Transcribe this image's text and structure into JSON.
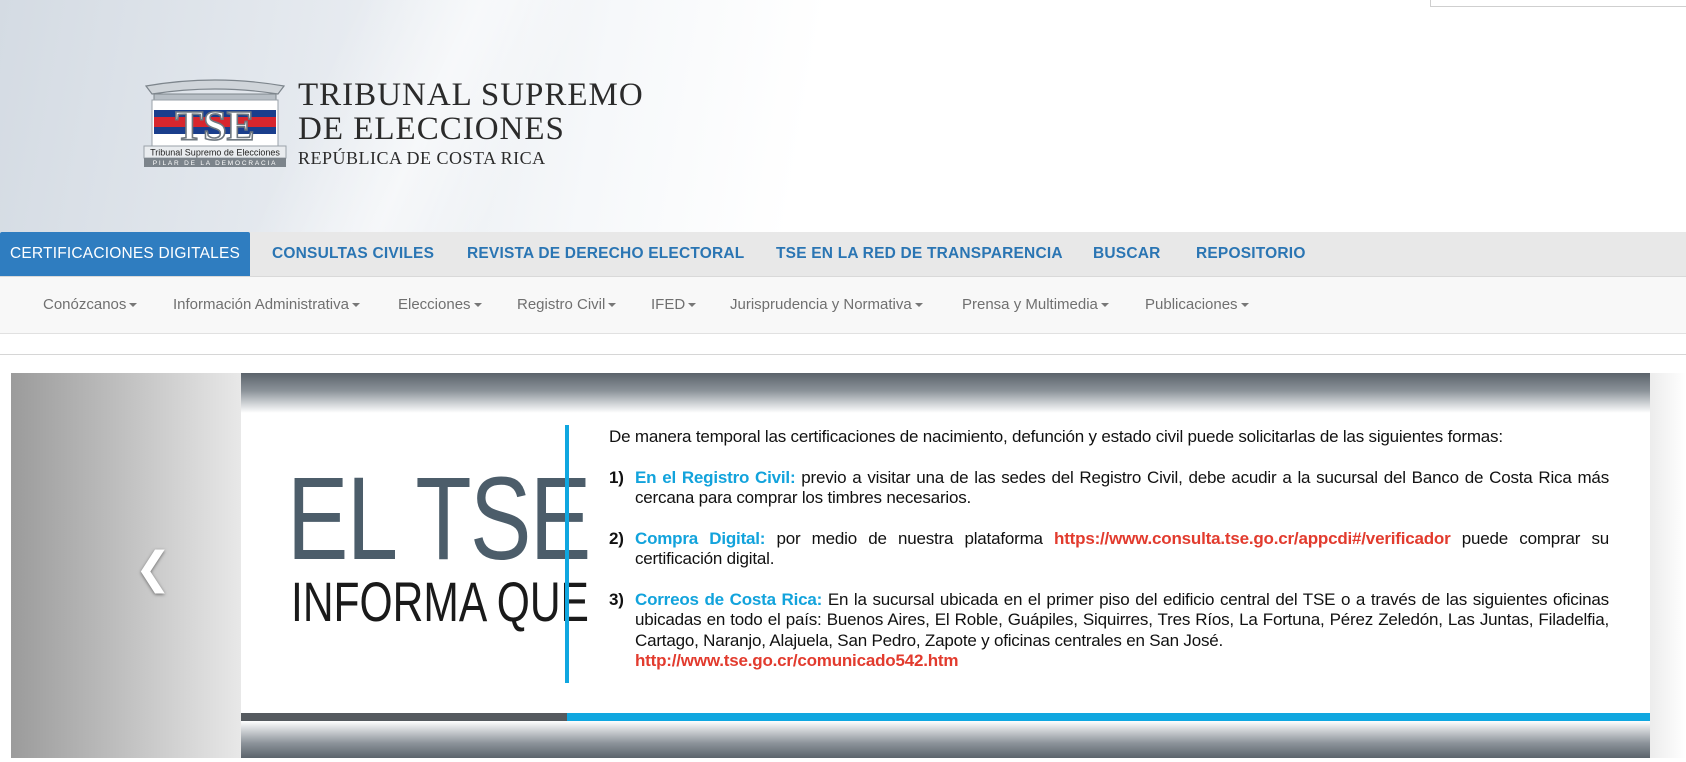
{
  "header": {
    "logo_text": "TSE",
    "logo_subtitle": "Tribunal Supremo de Elecciones",
    "logo_motto": "PILAR DE LA DEMOCRACIA",
    "title_line1": "TRIBUNAL SUPREMO",
    "title_line2": "DE ELECCIONES",
    "title_line3": "REPÚBLICA DE COSTA RICA"
  },
  "main_nav": {
    "items": [
      {
        "label": "CERTIFICACIONES DIGITALES",
        "active": true
      },
      {
        "label": "CONSULTAS CIVILES"
      },
      {
        "label": "REVISTA DE DERECHO ELECTORAL"
      },
      {
        "label": "TSE EN LA RED DE TRANSPARENCIA"
      },
      {
        "label": "BUSCAR"
      },
      {
        "label": "REPOSITORIO"
      }
    ]
  },
  "sub_nav": {
    "items": [
      {
        "label": "Conózcanos"
      },
      {
        "label": "Información Administrativa"
      },
      {
        "label": "Elecciones"
      },
      {
        "label": "Registro Civil"
      },
      {
        "label": "IFED"
      },
      {
        "label": "Jurisprudencia y Normativa"
      },
      {
        "label": "Prensa y Multimedia"
      },
      {
        "label": "Publicaciones"
      }
    ]
  },
  "carousel": {
    "prev_icon": "chevron-left-icon",
    "slide": {
      "headline1": "EL TSE",
      "headline2": "INFORMA QUE",
      "intro": "De manera temporal las certificaciones de nacimiento, defunción y estado civil  puede solicitarlas de las siguientes formas:",
      "steps": [
        {
          "num": "1)",
          "title": "En el Registro Civil:",
          "text": " previo a visitar una de las sedes del Registro Civil, debe acudir a la sucursal del Banco de Costa Rica más cercana para comprar los timbres necesarios."
        },
        {
          "num": "2)",
          "title": "Compra Digital:",
          "text": " por medio de nuestra plataforma ",
          "link": "https://www.consulta.tse.go.cr/appcdi#/verificador",
          "text_after": " puede comprar su certificación digital."
        },
        {
          "num": "3)",
          "title": "Correos de Costa Rica:",
          "text": " En la sucursal ubicada en el primer piso del edificio central del TSE o a través de las siguientes oficinas ubicadas en todo el país: Buenos Aires, El Roble, Guápiles, Siquirres, Tres Ríos, La Fortuna, Pérez Zeledón, Las Juntas, Filadelfia, Cartago, Naranjo, Alajuela, San Pedro, Zapote y oficinas centrales en San José.",
          "link": "http://www.tse.go.cr/comunicado542.htm"
        }
      ]
    }
  },
  "colors": {
    "nav_link": "#2a75b3",
    "nav_active_bg": "#2f7dc0",
    "highlight_blue": "#12a3dc",
    "link_red": "#e23b2e",
    "headline_gray": "#4c5d6a"
  }
}
